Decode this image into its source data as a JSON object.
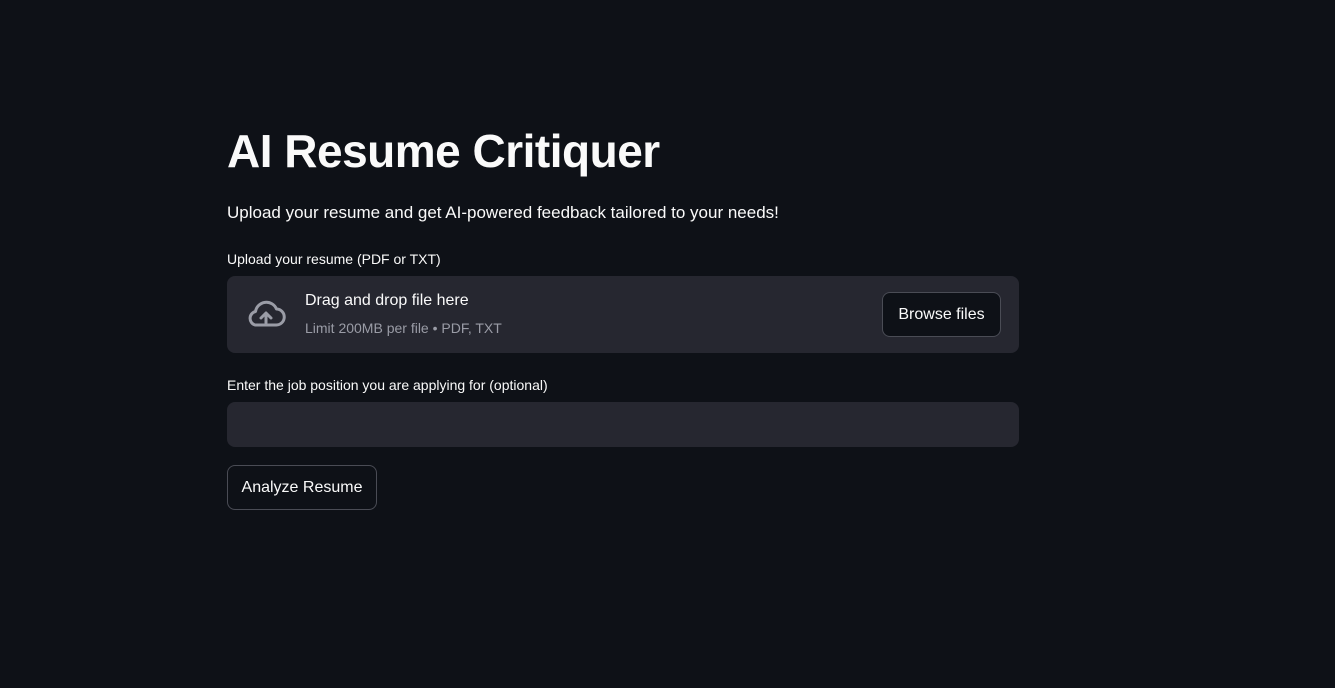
{
  "app": {
    "title": "AI Resume Critiquer",
    "subtitle": "Upload your resume and get AI-powered feedback tailored to your needs!"
  },
  "uploader": {
    "label": "Upload your resume (PDF or TXT)",
    "drop_title": "Drag and drop file here",
    "drop_hint": "Limit 200MB per file • PDF, TXT",
    "browse_label": "Browse files",
    "icon": "cloud-upload-icon"
  },
  "job_position": {
    "label": "Enter the job position you are applying for (optional)",
    "value": "",
    "placeholder": ""
  },
  "actions": {
    "analyze_label": "Analyze Resume"
  },
  "colors": {
    "background": "#0e1117",
    "surface": "#262730",
    "text": "#fafafa",
    "muted_text": "#9a9ca6",
    "border": "#4a4c55"
  }
}
